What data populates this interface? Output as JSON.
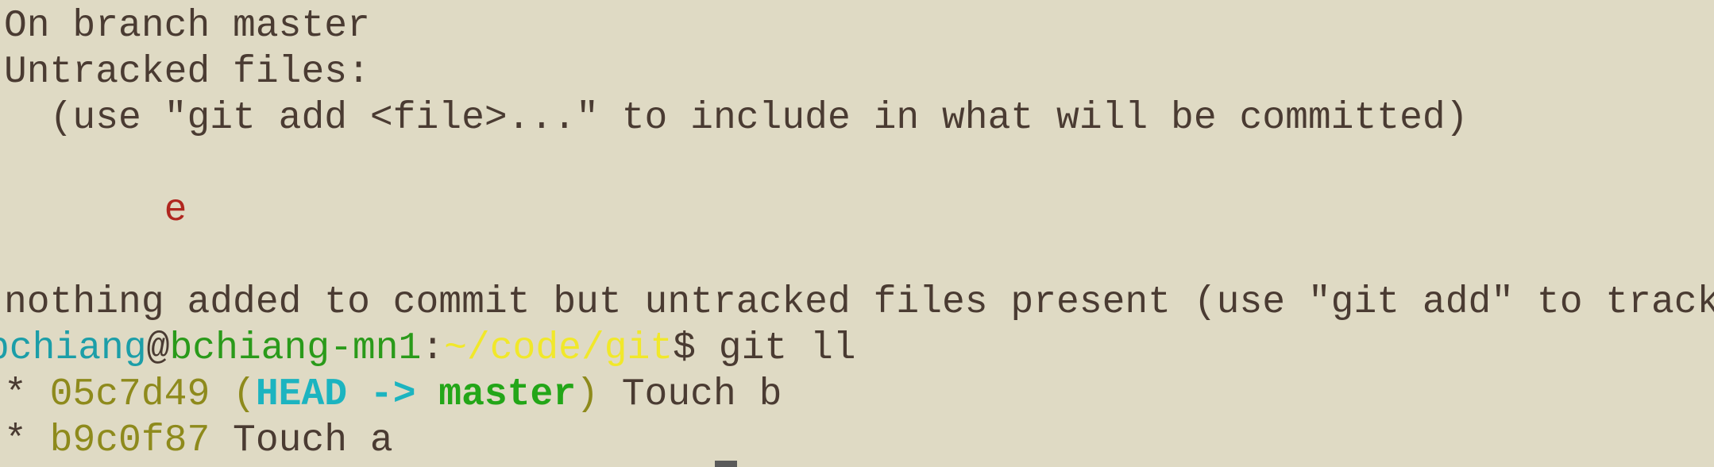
{
  "terminal": {
    "status_line": "On branch master",
    "untracked_header": "Untracked files:",
    "untracked_hint": "  (use \"git add <file>...\" to include in what will be committed)",
    "untracked_indent": "       ",
    "untracked_file": "e",
    "nothing_added": "nothing added to commit but untracked files present (use \"git add\" to track)",
    "prompt": {
      "user": "bchiang",
      "at": "@",
      "host": "bchiang-mn1",
      "colon": ":",
      "path": "~/code/git",
      "dollar": "$ ",
      "command": "git ll"
    },
    "log": [
      {
        "bullet": "* ",
        "hash": "05c7d49",
        "ref_open": " (",
        "head": "HEAD",
        "arrow": " -> ",
        "branch": "master",
        "ref_close": ")",
        "message": " Touch b"
      },
      {
        "bullet": "* ",
        "hash": "b9c0f87",
        "message": " Touch a"
      }
    ]
  },
  "colors": {
    "background": "#dfdac4",
    "foreground": "#4a3b32",
    "untracked": "#b0261f",
    "user": "#1c9ea8",
    "host": "#2a9a1a",
    "path": "#f1e82a",
    "hash": "#8e8a1c",
    "head": "#1cb4c0",
    "branch": "#23a618"
  }
}
